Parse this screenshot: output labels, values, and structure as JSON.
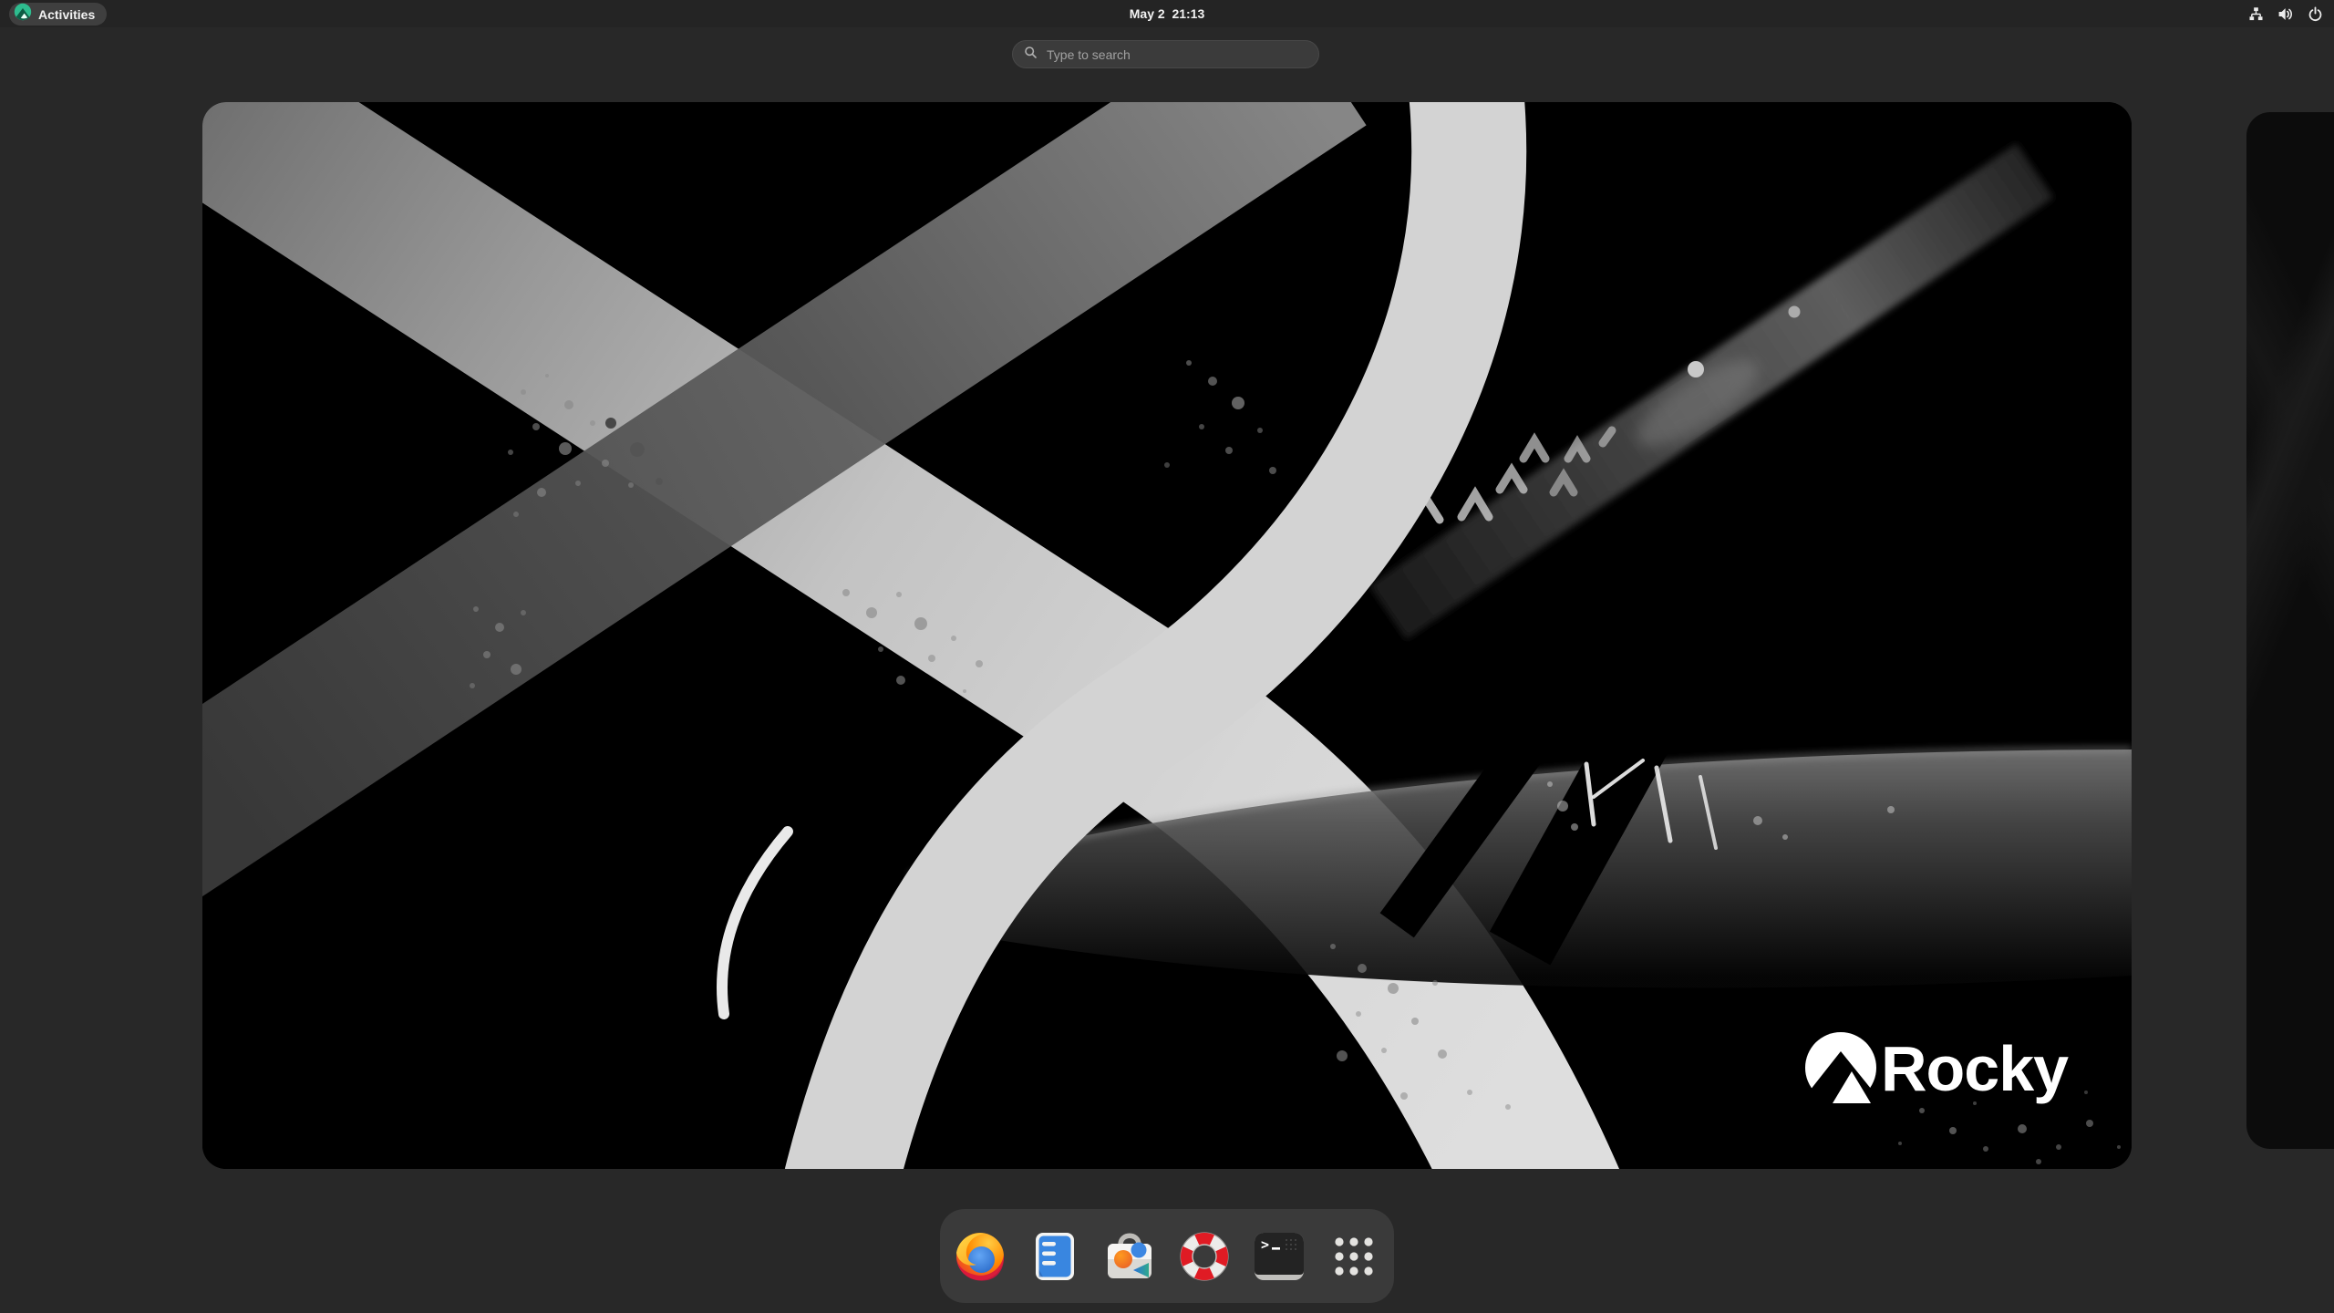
{
  "top_bar": {
    "activities": {
      "label": "Activities"
    },
    "clock": "May 2  21:13",
    "status_icons": [
      {
        "name": "network-wired-icon"
      },
      {
        "name": "volume-icon"
      },
      {
        "name": "power-icon"
      }
    ]
  },
  "search": {
    "placeholder": "Type to search"
  },
  "workspaces": {
    "current": {
      "logo_text": "Rocky"
    },
    "next": {
      "label": "adjacent-workspace-preview"
    }
  },
  "dock": {
    "items": [
      {
        "name": "firefox-browser"
      },
      {
        "name": "files"
      },
      {
        "name": "software-store"
      },
      {
        "name": "help"
      },
      {
        "name": "terminal"
      },
      {
        "name": "app-grid"
      }
    ]
  },
  "colors": {
    "rocky_green": "#2ebd8f",
    "desktop_bg": "#282828",
    "top_bar_bg": "#242424",
    "dock_bg": "#3a3a3a",
    "firefox_orange": "#ff8a00",
    "files_blue": "#3584e4",
    "help_red": "#e01b24",
    "software_teal": "#26a269"
  }
}
